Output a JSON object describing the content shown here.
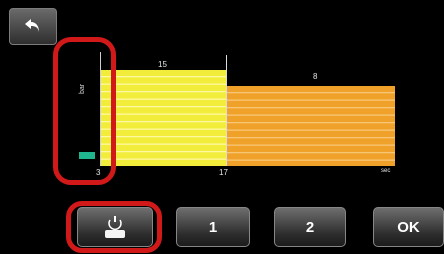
{
  "back_button": {
    "icon": "back-arrow-icon"
  },
  "chart": {
    "y_axis_label": "bar",
    "segments": [
      {
        "value_label": "15",
        "color": "#f2ec3a",
        "stripe": "#fff9a0"
      },
      {
        "value_label": "8",
        "color": "#f0a12a",
        "stripe": "#f7c675"
      }
    ],
    "x_ticks": [
      "3",
      "17",
      "sec"
    ],
    "marker_color": "#1fb58f",
    "highlight_color": "#d11919"
  },
  "buttons": {
    "pump_icon": "pump-icon",
    "btn_1": "1",
    "btn_2": "2",
    "ok": "OK"
  }
}
